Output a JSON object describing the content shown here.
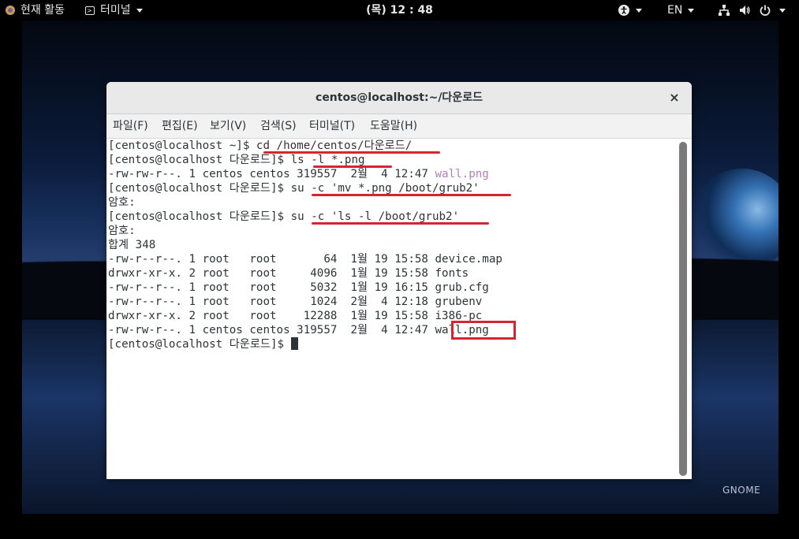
{
  "topbar": {
    "activities": "현재 활동",
    "app_menu": "터미널",
    "clock": "(목) 12 : 48",
    "language": "EN"
  },
  "window": {
    "title": "centos@localhost:~/다운로드",
    "close": "×",
    "menu": [
      "파일(F)",
      "편집(E)",
      "보기(V)",
      "검색(S)",
      "터미널(T)",
      "도움말(H)"
    ]
  },
  "terminal": {
    "lines": [
      "[centos@localhost ~]$ cd /home/centos/다운로드/",
      "[centos@localhost 다운로드]$ ls -l *.png",
      "-rw-rw-r--. 1 centos centos 319557  2월  4 12:47 ",
      "[centos@localhost 다운로드]$ su -c 'mv *.png /boot/grub2'",
      "암호:",
      "[centos@localhost 다운로드]$ su -c 'ls -l /boot/grub2'",
      "암호:",
      "합계 348",
      "-rw-r--r--. 1 root   root       64  1월 19 15:58 device.map",
      "drwxr-xr-x. 2 root   root     4096  1월 19 15:58 fonts",
      "-rw-r--r--. 1 root   root     5032  1월 19 16:15 grub.cfg",
      "-rw-r--r--. 1 root   root     1024  2월  4 12:18 grubenv",
      "drwxr-xr-x. 2 root   root    12288  1월 19 15:58 i386-pc",
      "-rw-rw-r--. 1 centos centos 319557  2월  4 12:47 wall.png",
      "[centos@localhost 다운로드]$ "
    ],
    "highlight_file": "wall.png"
  },
  "desktop": {
    "brand": "GNOME"
  },
  "colors": {
    "annotation_red": "#d3262f",
    "terminal_text": "#2e3436",
    "dim_text": "#b07fb5"
  }
}
